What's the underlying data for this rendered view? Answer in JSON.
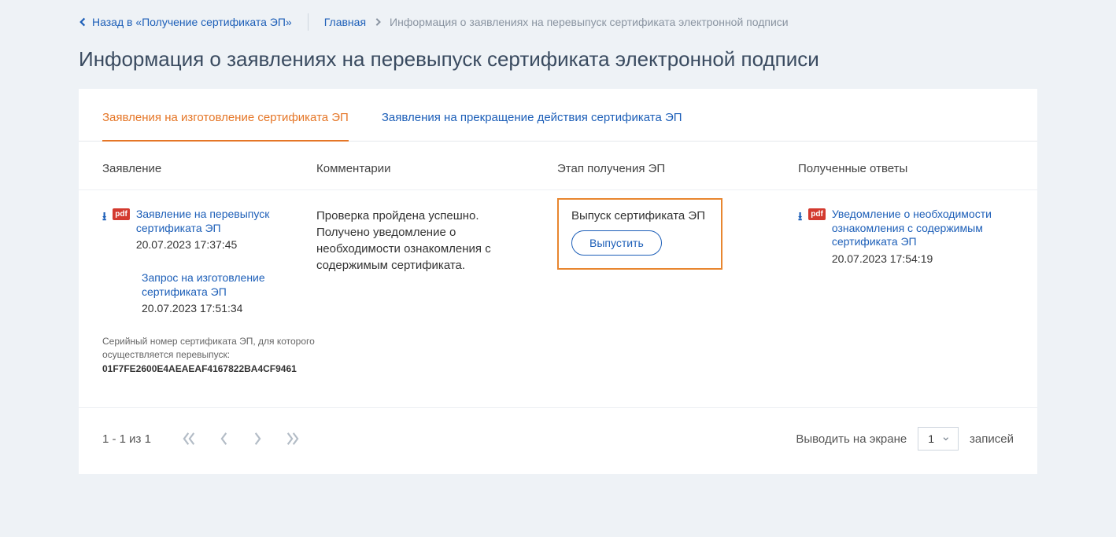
{
  "nav": {
    "back_label": "Назад в «Получение сертификата ЭП»",
    "home_label": "Главная",
    "current_crumb": "Информация о заявлениях на перевыпуск сертификата электронной подписи"
  },
  "page_title": "Информация о заявлениях на перевыпуск сертификата электронной подписи",
  "tabs": {
    "manufacture": "Заявления на изготовление сертификата ЭП",
    "terminate": "Заявления на прекращение действия сертификата ЭП"
  },
  "columns": {
    "application": "Заявление",
    "comments": "Комментарии",
    "stage": "Этап получения ЭП",
    "responses": "Полученные ответы"
  },
  "row": {
    "app_doc1": {
      "title": "Заявление на перевыпуск сертификата ЭП",
      "date": "20.07.2023 17:37:45",
      "badge": "pdf"
    },
    "app_doc2": {
      "title": "Запрос на изготовление сертификата ЭП",
      "date": "20.07.2023 17:51:34"
    },
    "serial_label": "Серийный номер сертификата ЭП, для которого осуществляется перевыпуск:",
    "serial_number": "01F7FE2600E4AEAEAF4167822BA4CF9461",
    "comment": "Проверка пройдена успешно. Получено уведомление о необходимости ознакомления с содержимым сертификата.",
    "stage_title": "Выпуск сертификата ЭП",
    "issue_button": "Выпустить",
    "resp_doc": {
      "title": "Уведомление о необходимости ознакомления с содержимым сертификата ЭП",
      "date": "20.07.2023 17:54:19",
      "badge": "pdf"
    }
  },
  "pager": {
    "status": "1 - 1 из 1",
    "per_page_label": "Выводить на экране",
    "per_page_value": "1",
    "records_label": "записей"
  }
}
